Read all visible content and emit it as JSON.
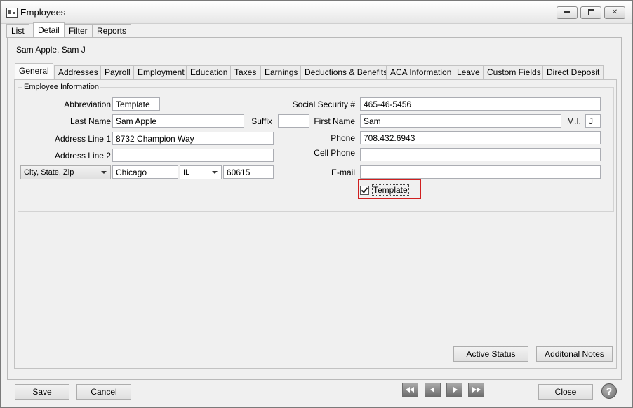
{
  "window": {
    "title": "Employees",
    "icon": "address-card-icon",
    "controls": {
      "minimize": "minimize-icon",
      "maximize": "maximize-icon",
      "close_label": "✕"
    }
  },
  "top_tabs": [
    "List",
    "Detail",
    "Filter",
    "Reports"
  ],
  "active_top_tab": "Detail",
  "employee_name": "Sam Apple, Sam J",
  "sub_tabs": [
    "General",
    "Addresses",
    "Payroll",
    "Employment",
    "Education",
    "Taxes",
    "Earnings",
    "Deductions & Benefits",
    "ACA Information",
    "Leave",
    "Custom Fields",
    "Direct Deposit"
  ],
  "active_sub_tab": "General",
  "employee_info": {
    "group_title": "Employee Information",
    "abbreviation": {
      "label": "Abbreviation",
      "value": "Template"
    },
    "last_name": {
      "label": "Last Name",
      "value": "Sam Apple"
    },
    "suffix": {
      "label": "Suffix",
      "value": ""
    },
    "first_name": {
      "label": "First Name",
      "value": "Sam"
    },
    "mi": {
      "label": "M.I.",
      "value": "J"
    },
    "ssn": {
      "label": "Social Security #",
      "value": "465-46-5456"
    },
    "address1": {
      "label": "Address Line 1",
      "value": "8732 Champion Way"
    },
    "address2": {
      "label": "Address Line 2",
      "value": ""
    },
    "city_state_zip": {
      "label": "City, State, Zip",
      "city": "Chicago",
      "state": "IL",
      "zip": "60615"
    },
    "phone": {
      "label": "Phone",
      "value": "708.432.6943"
    },
    "cell_phone": {
      "label": "Cell Phone",
      "value": ""
    },
    "email": {
      "label": "E-mail",
      "value": ""
    },
    "template_checkbox": {
      "label": "Template",
      "checked": true
    }
  },
  "panel_buttons": {
    "active_status": "Active Status",
    "additional_notes": "Additonal Notes"
  },
  "footer": {
    "save": "Save",
    "cancel": "Cancel",
    "close": "Close",
    "help": "?"
  },
  "colors": {
    "highlight": "#d01f1f",
    "window_bg": "#f0f0f0"
  }
}
